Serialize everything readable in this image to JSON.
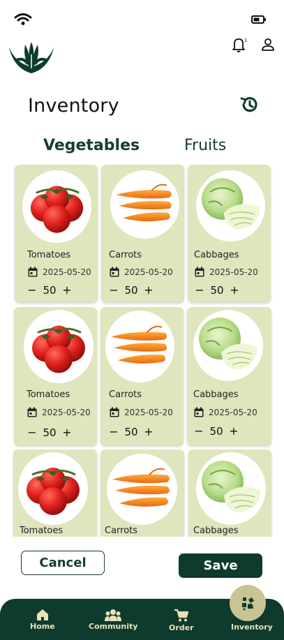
{
  "header": {
    "page_title": "Inventory",
    "notification_count": "1"
  },
  "tabs": [
    {
      "label": "Vegetables",
      "active": true
    },
    {
      "label": "Fruits",
      "active": false
    }
  ],
  "items": [
    {
      "name": "Tomatoes",
      "date": "2025-05-20",
      "qty": "50",
      "image": "tomato"
    },
    {
      "name": "Carrots",
      "date": "2025-05-20",
      "qty": "50",
      "image": "carrot"
    },
    {
      "name": "Cabbages",
      "date": "2025-05-20",
      "qty": "50",
      "image": "cabbage"
    },
    {
      "name": "Tomatoes",
      "date": "2025-05-20",
      "qty": "50",
      "image": "tomato"
    },
    {
      "name": "Carrots",
      "date": "2025-05-20",
      "qty": "50",
      "image": "carrot"
    },
    {
      "name": "Cabbages",
      "date": "2025-05-20",
      "qty": "50",
      "image": "cabbage"
    },
    {
      "name": "Tomatoes",
      "image": "tomato"
    },
    {
      "name": "Carrots",
      "image": "carrot"
    },
    {
      "name": "Cabbages",
      "image": "cabbage"
    }
  ],
  "qty_controls": {
    "minus": "−",
    "plus": "+"
  },
  "actions": {
    "cancel_label": "Cancel",
    "save_label": "Save"
  },
  "nav": {
    "items": [
      {
        "label": "Home",
        "icon": "home-icon"
      },
      {
        "label": "Community",
        "icon": "community-icon"
      },
      {
        "label": "Order",
        "icon": "cart-icon"
      },
      {
        "label": "Inventory",
        "icon": "inventory-icon",
        "active": true
      }
    ]
  },
  "colors": {
    "primary": "#0e3b2e",
    "card_bg": "#dfe5bd",
    "nav_active": "#c8c493",
    "nav_text": "#e8e2b8"
  }
}
